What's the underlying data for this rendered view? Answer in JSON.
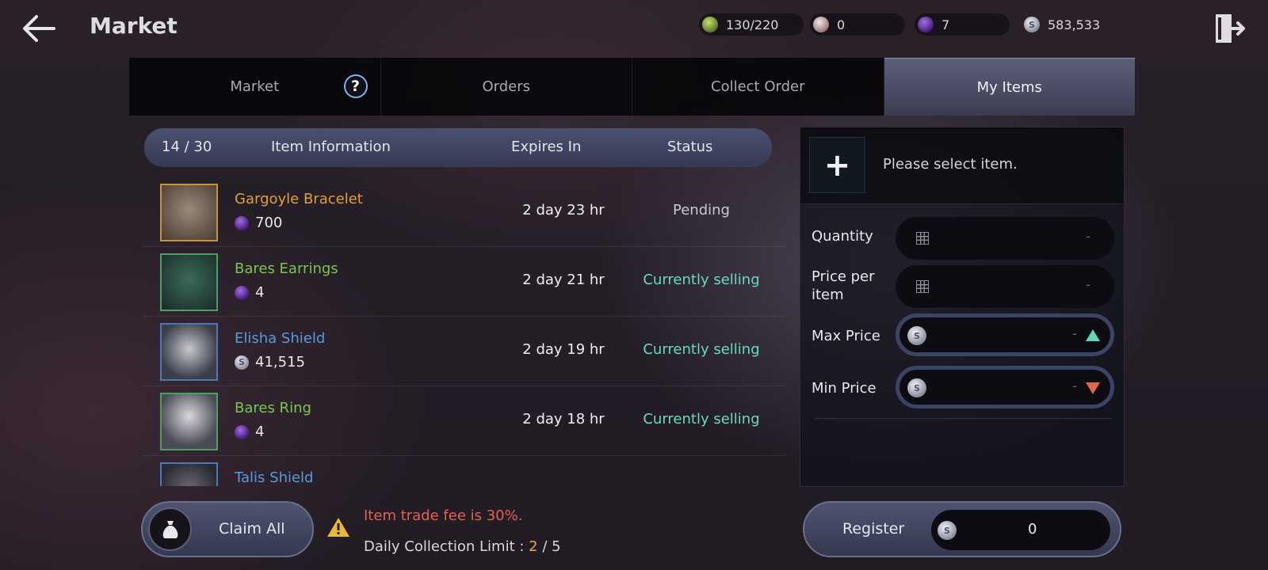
{
  "header": {
    "title": "Market",
    "currencies": [
      {
        "icon": "green-gem-icon",
        "value": "130/220"
      },
      {
        "icon": "pearl-icon",
        "value": "0"
      },
      {
        "icon": "purple-gem-icon",
        "value": "7"
      },
      {
        "icon": "silver-coin-icon",
        "value": "583,533"
      }
    ]
  },
  "tabs": [
    {
      "label": "Market",
      "active": false
    },
    {
      "label": "Orders",
      "active": false
    },
    {
      "label": "Collect Order",
      "active": false
    },
    {
      "label": "My Items",
      "active": true
    }
  ],
  "list": {
    "count": "14 / 30",
    "columns": {
      "info": "Item Information",
      "expires": "Expires In",
      "status": "Status"
    },
    "rows": [
      {
        "name": "Gargoyle Bracelet",
        "price": "700",
        "currency": "purple-gem-icon",
        "expires": "2 day 23 hr",
        "status": "Pending",
        "grade_color": "#e0a040",
        "status_color": "#c8c8d0",
        "thumb": "bracelet-icon"
      },
      {
        "name": "Bares Earrings",
        "price": "4",
        "currency": "purple-gem-icon",
        "expires": "2 day 21 hr",
        "status": "Currently selling",
        "grade_color": "#78c850",
        "status_color": "#6ad8c0",
        "thumb": "earrings-icon"
      },
      {
        "name": "Elisha Shield",
        "price": "41,515",
        "currency": "silver-coin-icon",
        "expires": "2 day 19 hr",
        "status": "Currently selling",
        "grade_color": "#5a9ad8",
        "status_color": "#6ad8c0",
        "thumb": "shield-icon"
      },
      {
        "name": "Bares Ring",
        "price": "4",
        "currency": "purple-gem-icon",
        "expires": "2 day 18 hr",
        "status": "Currently selling",
        "grade_color": "#78c850",
        "status_color": "#6ad8c0",
        "thumb": "ring-icon"
      },
      {
        "name": "Talis Shield",
        "price": "",
        "currency": "silver-coin-icon",
        "expires": "",
        "status": "",
        "grade_color": "#5a9ad8",
        "status_color": "#6ad8c0",
        "thumb": "shield-icon"
      }
    ]
  },
  "bottom": {
    "claim_label": "Claim All",
    "fee_text": "Item trade fee is 30%.",
    "limit_label": "Daily Collection Limit : ",
    "limit_current": "2",
    "limit_sep": " / ",
    "limit_max": "5"
  },
  "register_panel": {
    "placeholder": "Please select item.",
    "quantity_label": "Quantity",
    "quantity_value": "-",
    "price_label": "Price per item",
    "price_value": "-",
    "max_label": "Max Price",
    "max_value": "-",
    "min_label": "Min Price",
    "min_value": "-",
    "register_label": "Register",
    "register_amount": "0"
  }
}
